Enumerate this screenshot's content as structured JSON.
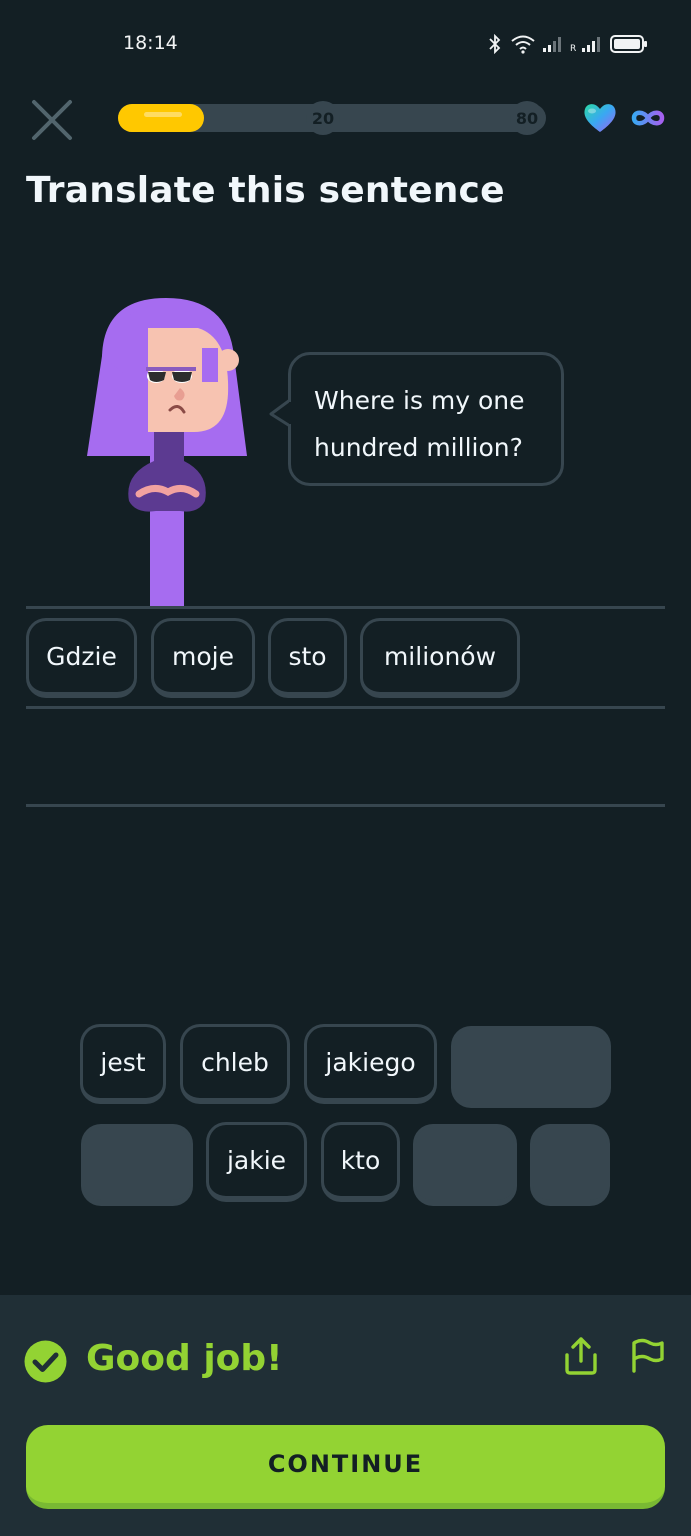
{
  "status_bar": {
    "time": "18:14",
    "icons": [
      "bluetooth-icon",
      "wifi-icon",
      "signal-icon",
      "signal-roaming-icon",
      "battery-icon"
    ],
    "roaming_label": "R"
  },
  "header": {
    "close_icon": "close-icon",
    "progress_fraction": 0.2,
    "milestones": [
      "20",
      "80"
    ],
    "progress_color": "#ffc800",
    "hearts_icon": "heart-icon",
    "hearts_count_icon": "infinity-icon"
  },
  "prompt": {
    "title": "Translate this sentence",
    "speech": "Where is my one hundred million?"
  },
  "answer": {
    "tiles": [
      "Gdzie",
      "moje",
      "sto",
      "milionów"
    ]
  },
  "word_bank": {
    "row1": [
      "jest",
      "chleb",
      "jakiego",
      ""
    ],
    "row2": [
      "",
      "jakie",
      "kto",
      "",
      ""
    ]
  },
  "footer": {
    "result": "Good job!",
    "result_icon": "check-circle-icon",
    "share_icon": "share-icon",
    "report_icon": "flag-icon",
    "continue_label": "CONTINUE",
    "accent": "#93d333"
  }
}
